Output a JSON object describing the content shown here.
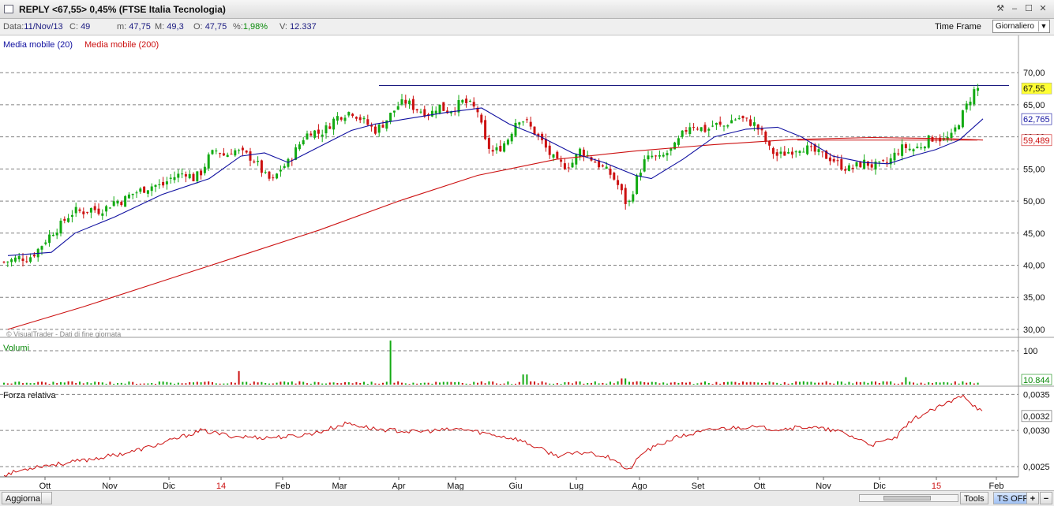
{
  "window": {
    "title": "REPLY <67,55> 0,45%  (FTSE Italia Tecnologia)"
  },
  "infobar": {
    "date_label": "Data:",
    "date": "11/Nov/13",
    "c_label": "C:",
    "c": "49",
    "m_label": "m:",
    "m": "47,75",
    "M_label": "M:",
    "M": "49,3",
    "o_label": "O:",
    "o": "47,75",
    "pct_label": "%:",
    "pct": "1,98%",
    "v_label": "V:",
    "v": "12.337",
    "timeframe_label": "Time Frame",
    "timeframe_value": "Giornaliero"
  },
  "legend": {
    "ma20": "Media mobile (20)",
    "ma200": "Media mobile (200)"
  },
  "colors": {
    "ma20": "#1010a0",
    "ma200": "#cc1111",
    "up": "#12aa12",
    "down": "#cc1111",
    "last_price_bg": "#ffff33",
    "grid": "#808080"
  },
  "watermark": "© VisualTrader - Dati di fine giornata",
  "panels": {
    "volume_title": "Volumi",
    "rs_title": "Forza relativa"
  },
  "chart_data": [
    {
      "type": "candlestick",
      "title": "REPLY",
      "ylim": [
        29.5,
        71.5
      ],
      "yticks": [
        "70,00",
        "65,00",
        "60,00",
        "55,00",
        "50,00",
        "45,00",
        "40,00",
        "35,00",
        "30,00"
      ],
      "months": [
        "Ott",
        "Nov",
        "Dic",
        "14",
        "Feb",
        "Mar",
        "Apr",
        "Mag",
        "Giu",
        "Lug",
        "Ago",
        "Set",
        "Ott",
        "Nov",
        "Dic",
        "15",
        "Feb"
      ],
      "close_path": [
        [
          0,
          40.5
        ],
        [
          10,
          40.8
        ],
        [
          20,
          41.2
        ],
        [
          30,
          41.0
        ],
        [
          40,
          42.0
        ],
        [
          50,
          43.5
        ],
        [
          60,
          45.0
        ],
        [
          70,
          46.0
        ],
        [
          80,
          47.5
        ],
        [
          90,
          48.5
        ],
        [
          100,
          48.3
        ],
        [
          110,
          48.8
        ],
        [
          120,
          48.5
        ],
        [
          130,
          49.0
        ],
        [
          140,
          50.0
        ],
        [
          150,
          50.0
        ],
        [
          160,
          51.0
        ],
        [
          170,
          51.5
        ],
        [
          180,
          52.0
        ],
        [
          190,
          52.5
        ],
        [
          200,
          52.3
        ],
        [
          210,
          53.5
        ],
        [
          220,
          54.0
        ],
        [
          230,
          54.5
        ],
        [
          240,
          53.5
        ],
        [
          250,
          54.5
        ],
        [
          260,
          57.0
        ],
        [
          270,
          58.0
        ],
        [
          280,
          57.0
        ],
        [
          290,
          58.0
        ],
        [
          300,
          57.5
        ],
        [
          310,
          57.0
        ],
        [
          320,
          56.0
        ],
        [
          330,
          54.0
        ],
        [
          340,
          53.0
        ],
        [
          350,
          55.0
        ],
        [
          360,
          56.0
        ],
        [
          370,
          58.0
        ],
        [
          380,
          60.0
        ],
        [
          390,
          61.0
        ],
        [
          400,
          60.5
        ],
        [
          410,
          61.5
        ],
        [
          420,
          63.0
        ],
        [
          430,
          63.5
        ],
        [
          440,
          64.0
        ],
        [
          450,
          63.0
        ],
        [
          460,
          62.0
        ],
        [
          470,
          61.0
        ],
        [
          480,
          62.0
        ],
        [
          490,
          63.5
        ],
        [
          500,
          65.0
        ],
        [
          510,
          65.5
        ],
        [
          520,
          64.5
        ],
        [
          530,
          64.0
        ],
        [
          540,
          63.5
        ],
        [
          550,
          65.0
        ],
        [
          560,
          64.0
        ],
        [
          570,
          64.5
        ],
        [
          580,
          65.5
        ],
        [
          590,
          65.0
        ],
        [
          600,
          64.0
        ],
        [
          610,
          59.0
        ],
        [
          620,
          57.5
        ],
        [
          630,
          58.5
        ],
        [
          640,
          60.0
        ],
        [
          650,
          63.0
        ],
        [
          660,
          62.5
        ],
        [
          670,
          61.0
        ],
        [
          680,
          59.5
        ],
        [
          690,
          57.5
        ],
        [
          700,
          56.0
        ],
        [
          710,
          55.5
        ],
        [
          720,
          56.0
        ],
        [
          730,
          58.0
        ],
        [
          740,
          57.0
        ],
        [
          750,
          56.0
        ],
        [
          760,
          55.0
        ],
        [
          770,
          54.0
        ],
        [
          780,
          52.0
        ],
        [
          790,
          49.0
        ],
        [
          800,
          53.0
        ],
        [
          810,
          56.0
        ],
        [
          820,
          57.0
        ],
        [
          830,
          56.5
        ],
        [
          840,
          57.5
        ],
        [
          850,
          58.5
        ],
        [
          860,
          60.5
        ],
        [
          870,
          62.0
        ],
        [
          880,
          61.5
        ],
        [
          890,
          61.0
        ],
        [
          900,
          62.0
        ],
        [
          910,
          61.5
        ],
        [
          920,
          62.5
        ],
        [
          930,
          63.0
        ],
        [
          940,
          62.5
        ],
        [
          950,
          62.0
        ],
        [
          960,
          60.5
        ],
        [
          970,
          58.0
        ],
        [
          980,
          57.0
        ],
        [
          990,
          57.5
        ],
        [
          1000,
          58.0
        ],
        [
          1010,
          58.5
        ],
        [
          1020,
          58.0
        ],
        [
          1030,
          57.5
        ],
        [
          1040,
          57.0
        ],
        [
          1050,
          56.5
        ],
        [
          1060,
          55.5
        ],
        [
          1070,
          55.0
        ],
        [
          1080,
          55.5
        ],
        [
          1090,
          56.0
        ],
        [
          1100,
          55.5
        ],
        [
          1110,
          55.5
        ],
        [
          1120,
          56.0
        ],
        [
          1130,
          57.5
        ],
        [
          1140,
          58.5
        ],
        [
          1150,
          58.0
        ],
        [
          1160,
          58.5
        ],
        [
          1170,
          59.5
        ],
        [
          1180,
          60.0
        ],
        [
          1190,
          59.5
        ],
        [
          1200,
          60.0
        ],
        [
          1210,
          62.5
        ],
        [
          1220,
          65.0
        ],
        [
          1230,
          67.5
        ]
      ],
      "ma20_path": [
        [
          5,
          41.5
        ],
        [
          60,
          42.0
        ],
        [
          90,
          45.0
        ],
        [
          140,
          47.5
        ],
        [
          200,
          51.0
        ],
        [
          260,
          53.5
        ],
        [
          300,
          57.0
        ],
        [
          330,
          57.5
        ],
        [
          360,
          56.0
        ],
        [
          400,
          58.5
        ],
        [
          440,
          61.0
        ],
        [
          470,
          62.0
        ],
        [
          520,
          63.0
        ],
        [
          560,
          63.8
        ],
        [
          605,
          64.5
        ],
        [
          640,
          62.0
        ],
        [
          680,
          60.0
        ],
        [
          720,
          57.5
        ],
        [
          760,
          56.0
        ],
        [
          800,
          54.0
        ],
        [
          820,
          53.5
        ],
        [
          860,
          56.5
        ],
        [
          900,
          60.0
        ],
        [
          940,
          61.2
        ],
        [
          980,
          61.5
        ],
        [
          1010,
          60.0
        ],
        [
          1050,
          57.0
        ],
        [
          1090,
          56.0
        ],
        [
          1120,
          55.8
        ],
        [
          1150,
          57.0
        ],
        [
          1180,
          58.0
        ],
        [
          1210,
          59.5
        ],
        [
          1240,
          62.8
        ]
      ],
      "ma200_path": [
        [
          5,
          30.0
        ],
        [
          100,
          33.5
        ],
        [
          200,
          37.5
        ],
        [
          300,
          41.5
        ],
        [
          400,
          45.5
        ],
        [
          500,
          50.0
        ],
        [
          600,
          54.0
        ],
        [
          700,
          56.5
        ],
        [
          800,
          57.8
        ],
        [
          900,
          58.8
        ],
        [
          1000,
          59.6
        ],
        [
          1100,
          59.9
        ],
        [
          1200,
          59.7
        ],
        [
          1240,
          59.5
        ]
      ],
      "resistance_level": 68.0,
      "last_price": "67,55",
      "ma20_value": "62,765",
      "ma200_value": "59,489"
    },
    {
      "type": "bar",
      "title": "Volumi",
      "ylim": [
        0,
        135
      ],
      "ytick": "100",
      "last_value": "10.844",
      "spikes": [
        [
          303,
          40
        ],
        [
          493,
          130
        ],
        [
          665,
          30
        ],
        [
          790,
          18
        ],
        [
          1148,
          22
        ]
      ]
    },
    {
      "type": "line",
      "title": "Forza relativa",
      "ylim": [
        0.00238,
        0.00358
      ],
      "yticks": [
        "0,0035",
        "0,0030",
        "0,0025"
      ],
      "last_value": "0,0032",
      "path": [
        [
          5,
          0.0024
        ],
        [
          40,
          0.0025
        ],
        [
          80,
          0.00255
        ],
        [
          120,
          0.00262
        ],
        [
          160,
          0.0027
        ],
        [
          200,
          0.00282
        ],
        [
          250,
          0.003
        ],
        [
          290,
          0.00292
        ],
        [
          330,
          0.0029
        ],
        [
          370,
          0.00292
        ],
        [
          400,
          0.00298
        ],
        [
          435,
          0.0031
        ],
        [
          470,
          0.00302
        ],
        [
          520,
          0.00298
        ],
        [
          580,
          0.00302
        ],
        [
          610,
          0.00296
        ],
        [
          650,
          0.00288
        ],
        [
          700,
          0.00265
        ],
        [
          740,
          0.0027
        ],
        [
          775,
          0.0026
        ],
        [
          790,
          0.00243
        ],
        [
          810,
          0.0027
        ],
        [
          850,
          0.0029
        ],
        [
          900,
          0.00302
        ],
        [
          940,
          0.00305
        ],
        [
          980,
          0.00302
        ],
        [
          1020,
          0.00305
        ],
        [
          1060,
          0.00298
        ],
        [
          1100,
          0.0028
        ],
        [
          1130,
          0.0029
        ],
        [
          1150,
          0.00315
        ],
        [
          1180,
          0.0033
        ],
        [
          1200,
          0.0034
        ],
        [
          1215,
          0.0035
        ],
        [
          1225,
          0.00338
        ],
        [
          1240,
          0.00325
        ]
      ]
    }
  ]
}
